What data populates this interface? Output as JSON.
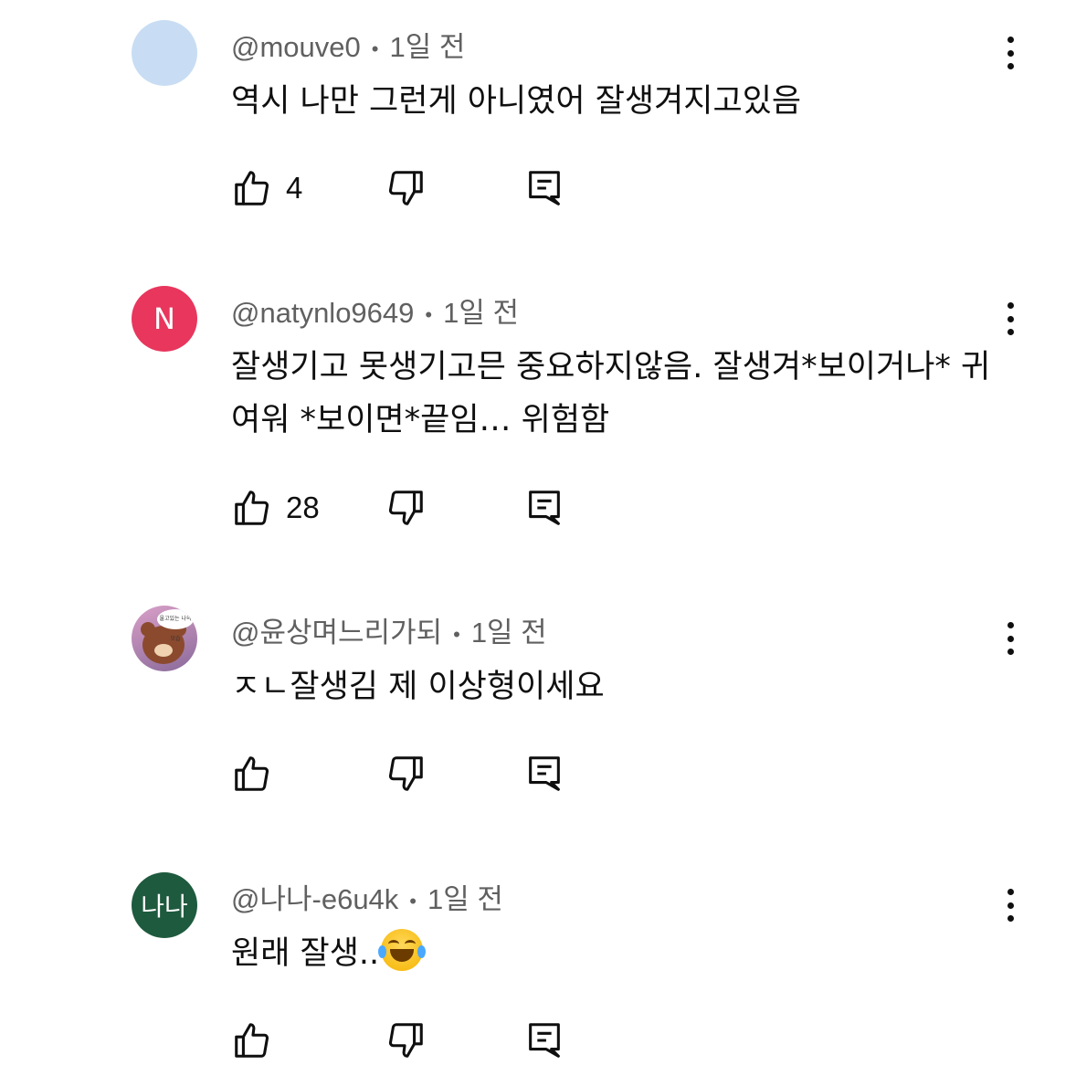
{
  "comments": [
    {
      "author": "@mouve0",
      "time": "1일 전",
      "text": "역시 나만 그런게 아니였어 잘생겨지고있음",
      "likes": "4",
      "avatar": {
        "type": "blank",
        "color": "#c8ddf3",
        "letter": ""
      }
    },
    {
      "author": "@natynlo9649",
      "time": "1일 전",
      "text": "잘생기고 못생기고믄 중요하지않음. 잘생겨*보이거나* 귀여워 *보이면*끝임… 위험함",
      "likes": "28",
      "avatar": {
        "type": "letter",
        "color": "#e8365d",
        "letter": "N"
      }
    },
    {
      "author": "@윤상며느리가되",
      "time": "1일 전",
      "text": "ㅈㄴ잘생김 제 이상형이세요",
      "likes": "",
      "avatar": {
        "type": "image",
        "color": "#b07aa0",
        "letter": "",
        "bubble_text": "울고있는 나의 모습"
      }
    },
    {
      "author": "@나나-e6u4k",
      "time": "1일 전",
      "text": "원래 잘생..",
      "likes": "",
      "avatar": {
        "type": "letter",
        "color": "#1e5a3e",
        "letter": "나나"
      },
      "emoji": "face-with-tears-of-joy"
    }
  ],
  "icons": {
    "like": "thumbs-up-icon",
    "dislike": "thumbs-down-icon",
    "reply": "comment-icon",
    "more": "more-vertical-icon"
  },
  "separator": "•"
}
